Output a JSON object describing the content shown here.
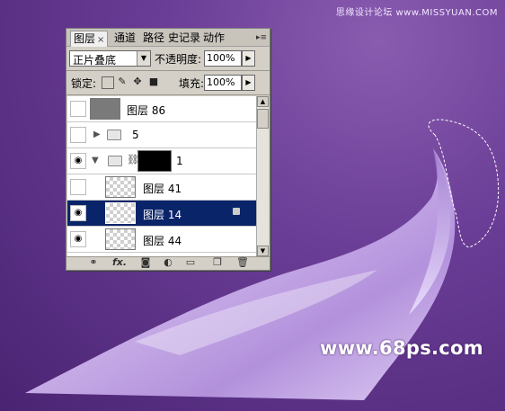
{
  "watermark_top": "思缘设计论坛  www.MISSYUAN.COM",
  "watermark_bottom": "www.68ps.com",
  "panel": {
    "tabs": [
      {
        "label": "图层",
        "active": true
      },
      {
        "label": "通道"
      },
      {
        "label": "路径"
      },
      {
        "label": "史记录"
      },
      {
        "label": "动作"
      }
    ],
    "tab_close": "×",
    "menu_icon": "▸≡",
    "blend_mode": "正片叠底",
    "opacity_label": "不透明度:",
    "opacity_value": "100%",
    "lock_label": "锁定:",
    "fill_label": "填充:",
    "fill_value": "100%",
    "layers": [
      {
        "name": "图层 86",
        "visible": false,
        "thumb": "gray"
      },
      {
        "name": "5",
        "visible": false,
        "type": "group",
        "expanded": false
      },
      {
        "name": "1",
        "visible": true,
        "type": "group",
        "expanded": true
      },
      {
        "name": "图层 41",
        "visible": false,
        "thumb": "checker"
      },
      {
        "name": "图层 14",
        "visible": true,
        "thumb": "checker",
        "selected": true
      },
      {
        "name": "图层 44",
        "visible": true,
        "thumb": "checker"
      }
    ],
    "bottom_icons": [
      "link-icon",
      "fx-icon",
      "mask-icon",
      "adjustment-icon",
      "group-icon",
      "new-layer-icon",
      "trash-icon"
    ],
    "fx_label": "fx."
  },
  "colors": {
    "background": "#6a3d96",
    "selected_row": "#0a246a",
    "silk": "#d8c4f0"
  }
}
